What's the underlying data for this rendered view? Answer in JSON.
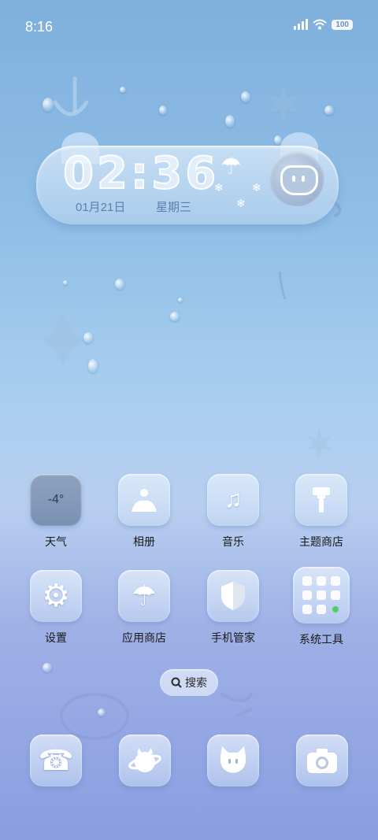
{
  "status_bar": {
    "time": "8:16",
    "battery": "100",
    "icons": [
      "signal-icon",
      "wifi-icon",
      "battery-icon"
    ]
  },
  "clock_widget": {
    "time": "02:36",
    "date": "01月21日",
    "weekday": "星期三"
  },
  "apps_row1": [
    {
      "label": "天气",
      "value": "-4°",
      "icon": "weather-icon"
    },
    {
      "label": "相册",
      "icon": "gallery-icon"
    },
    {
      "label": "音乐",
      "icon": "music-icon"
    },
    {
      "label": "主题商店",
      "icon": "theme-store-icon"
    }
  ],
  "apps_row2": [
    {
      "label": "设置",
      "icon": "settings-gear-icon"
    },
    {
      "label": "应用商店",
      "icon": "app-store-umbrella-icon"
    },
    {
      "label": "手机管家",
      "icon": "shield-icon"
    },
    {
      "label": "系统工具",
      "icon": "system-tools-folder-icon"
    }
  ],
  "search": {
    "label": "搜索"
  },
  "dock": [
    {
      "icon": "phone-icon"
    },
    {
      "icon": "browser-planet-icon"
    },
    {
      "icon": "messages-cat-icon"
    },
    {
      "icon": "camera-icon"
    }
  ],
  "colors": {
    "background_top": "#7fb0dc",
    "background_bottom": "#8a9ee0",
    "text": "#1a1a1a",
    "accent_green": "#4cd164"
  }
}
